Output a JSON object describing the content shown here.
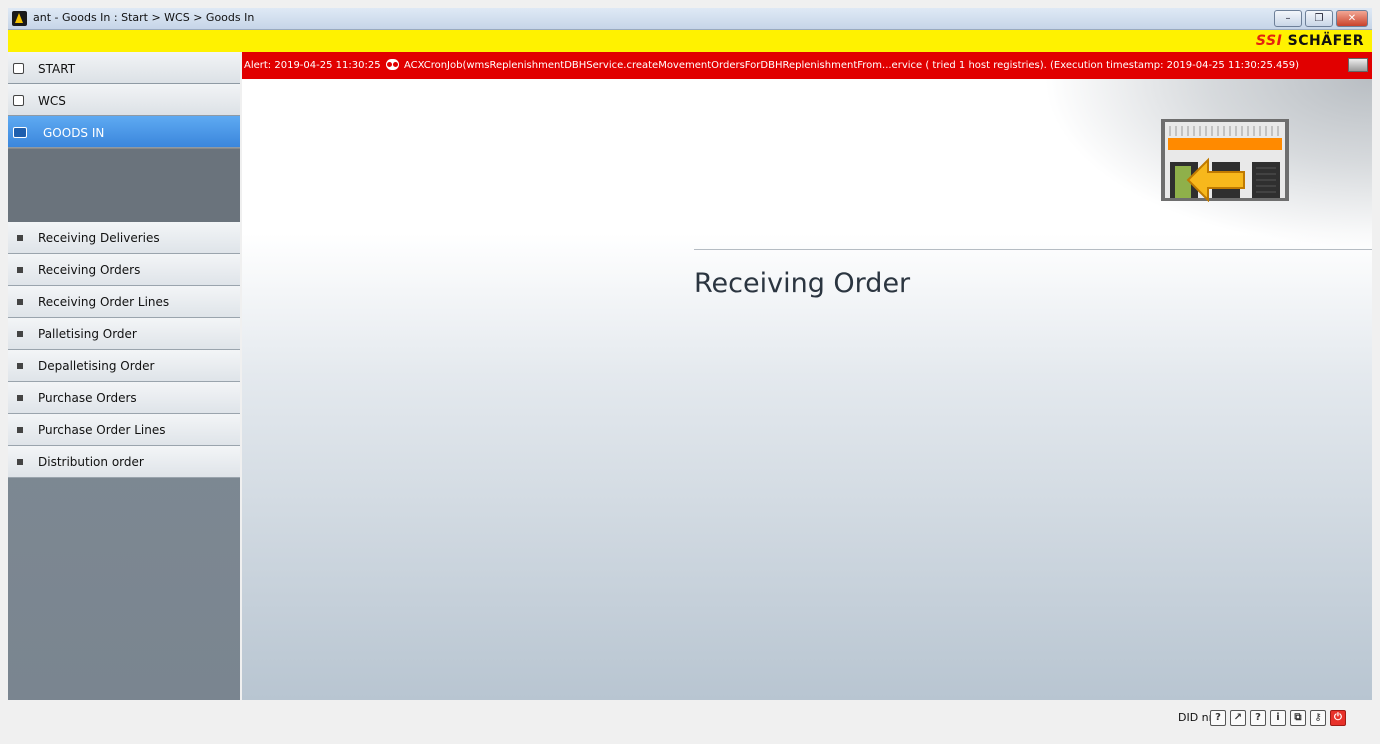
{
  "window": {
    "title": "ant - Goods In : Start > WCS > Goods In",
    "minimize": "–",
    "restore": "❐",
    "close": "✕"
  },
  "brand": {
    "ssi": "SSI",
    "name": "SCHÄFER"
  },
  "nav": {
    "start": "START",
    "wcs": "WCS",
    "goods_in": "GOODS IN"
  },
  "submenu": [
    "Receiving Deliveries",
    "Receiving Orders",
    "Receiving Order Lines",
    "Palletising Order",
    "Depalletising Order",
    "Purchase Orders",
    "Purchase Order Lines",
    "Distribution order"
  ],
  "alert": {
    "prefix": "Alert: 2019-04-25 11:30:25",
    "message": "ACXCronJob(wmsReplenishmentDBHService.createMovementOrdersForDBHReplenishmentFrom...ervice ( tried 1 host registries). (Execution timestamp: 2019-04-25 11:30:25.459)"
  },
  "main": {
    "title": "Receiving Order"
  },
  "status": {
    "did": "DID nn",
    "icons": [
      "help-icon",
      "export-icon",
      "help-icon",
      "info-icon",
      "window-icon",
      "key-icon",
      "power-icon"
    ],
    "glyphs": [
      "?",
      "↗",
      "?",
      "i",
      "⧉",
      "⚷",
      "⏻"
    ]
  },
  "colors": {
    "alert": "#e10000",
    "brand_bar": "#fff200",
    "active_nav": "#3b86dc",
    "logo_accent": "#e3230f"
  }
}
